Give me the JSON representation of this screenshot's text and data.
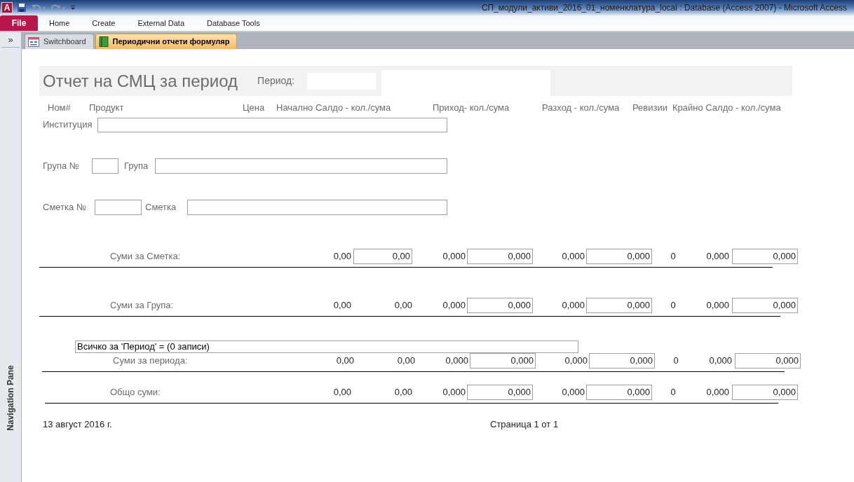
{
  "title_bar": {
    "app_icon": "A",
    "title": "СП_модули_активи_2016_01_номенклатура_local : Database (Access 2007)  -  Microsoft Access"
  },
  "ribbon": {
    "tabs": [
      {
        "label": "File",
        "kind": "file"
      },
      {
        "label": "Home",
        "kind": "tab"
      },
      {
        "label": "Create",
        "kind": "tab"
      },
      {
        "label": "External Data",
        "kind": "tab"
      },
      {
        "label": "Database Tools",
        "kind": "tab"
      }
    ]
  },
  "navigation_pane": {
    "toggle": "»",
    "label": "Navigation Pane"
  },
  "document_tabs": [
    {
      "label": "Switchboard",
      "kind": "form",
      "selected": false
    },
    {
      "label": "Периодични отчети формуляр",
      "kind": "report",
      "selected": true
    }
  ],
  "report": {
    "title": "Отчет на СМЦ за период",
    "period_label": "Период:",
    "column_headers": [
      "Ном#",
      "Продукт",
      "Цена",
      "Начално Салдо - кол./сума",
      "Приход- кол./сума",
      "Разход - кол./сума",
      "Ревизии",
      "Крайно Салдо - кол./сума"
    ],
    "institution_label": "Институция",
    "group_no_label": "Група №",
    "group_label": "Група",
    "account_no_label": "Сметка №",
    "account_label": "Сметка",
    "sum_rows": [
      {
        "label": "Суми за Сметка:",
        "cells": [
          {
            "value": "0,00",
            "boxed": false
          },
          {
            "value": "0,00",
            "boxed": true
          },
          {
            "value": "0,000",
            "boxed": false
          },
          {
            "value": "0,000",
            "boxed": true
          },
          {
            "value": "0,000",
            "boxed": false
          },
          {
            "value": "0,000",
            "boxed": true
          },
          {
            "value": "0",
            "boxed": false
          },
          {
            "value": "0,000",
            "boxed": false
          },
          {
            "value": "0,000",
            "boxed": true
          }
        ]
      },
      {
        "label": "Суми за Група:",
        "cells": [
          {
            "value": "0,00",
            "boxed": false
          },
          {
            "value": "0,00",
            "boxed": false
          },
          {
            "value": "0,000",
            "boxed": false
          },
          {
            "value": "0,000",
            "boxed": true
          },
          {
            "value": "0,000",
            "boxed": false
          },
          {
            "value": "0,000",
            "boxed": true
          },
          {
            "value": "0",
            "boxed": false
          },
          {
            "value": "0,000",
            "boxed": false
          },
          {
            "value": "0,000",
            "boxed": true
          }
        ]
      },
      {
        "label": "Суми за периода:",
        "cells": [
          {
            "value": "0,00",
            "boxed": false
          },
          {
            "value": "0,00",
            "boxed": false
          },
          {
            "value": "0,000",
            "boxed": false
          },
          {
            "value": "0,000",
            "boxed": true
          },
          {
            "value": "0,000",
            "boxed": false
          },
          {
            "value": "0,000",
            "boxed": true
          },
          {
            "value": "0",
            "boxed": false
          },
          {
            "value": "0,000",
            "boxed": false
          },
          {
            "value": "0,000",
            "boxed": true
          }
        ]
      },
      {
        "label": "Общо суми:",
        "cells": [
          {
            "value": "0,00",
            "boxed": false
          },
          {
            "value": "0,00",
            "boxed": false
          },
          {
            "value": "0,000",
            "boxed": false
          },
          {
            "value": "0,000",
            "boxed": true
          },
          {
            "value": "0,000",
            "boxed": false
          },
          {
            "value": "0,000",
            "boxed": true
          },
          {
            "value": "0",
            "boxed": false
          },
          {
            "value": "0,000",
            "boxed": false
          },
          {
            "value": "0,000",
            "boxed": true
          }
        ]
      }
    ],
    "period_total": "Всичко за 'Период' =  (0 записи)",
    "footer": {
      "date": "13 август 2016 г.",
      "page": "Страница 1 от 1"
    }
  }
}
